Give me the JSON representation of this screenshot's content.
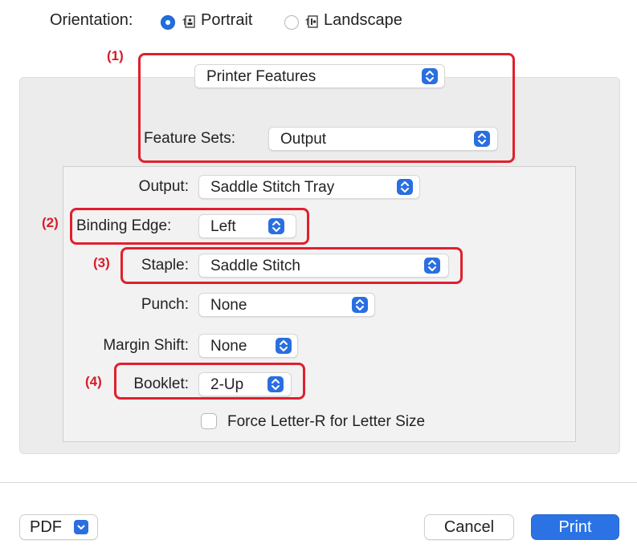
{
  "orientation": {
    "label": "Orientation:",
    "options": [
      {
        "label": "Portrait",
        "selected": true
      },
      {
        "label": "Landscape",
        "selected": false
      }
    ]
  },
  "callouts": [
    "(1)",
    "(2)",
    "(3)",
    "(4)"
  ],
  "printer_features": {
    "menu_value": "Printer Features",
    "feature_sets_label": "Feature Sets:",
    "feature_sets_value": "Output"
  },
  "settings": {
    "output_label": "Output:",
    "output_value": "Saddle Stitch Tray",
    "binding_label": "Binding Edge:",
    "binding_value": "Left",
    "staple_label": "Staple:",
    "staple_value": "Saddle Stitch",
    "punch_label": "Punch:",
    "punch_value": "None",
    "margin_label": "Margin Shift:",
    "margin_value": "None",
    "booklet_label": "Booklet:",
    "booklet_value": "2-Up",
    "force_letter_label": "Force Letter-R for Letter Size",
    "force_letter_checked": false
  },
  "footer": {
    "pdf_label": "PDF",
    "cancel_label": "Cancel",
    "print_label": "Print"
  },
  "colors": {
    "accent": "#2b73e4",
    "highlight": "#e0202e"
  }
}
